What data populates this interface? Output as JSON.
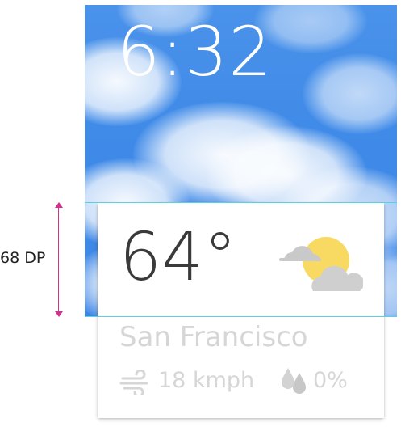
{
  "watch_face": {
    "time": "6:32"
  },
  "annotation": {
    "height_label": "68 DP",
    "colors": {
      "guide": "#5ad0e0",
      "measure": "#d4308f"
    }
  },
  "weather_card": {
    "temperature": "64°",
    "condition_icon": "partly-cloudy-icon",
    "city": "San Francisco",
    "wind": {
      "icon": "wind-icon",
      "value": "18 kmph"
    },
    "precipitation": {
      "icon": "raindrops-icon",
      "value": "0%"
    }
  },
  "colors": {
    "sky": "#4a92ea",
    "sun": "#f8da62",
    "cloud": "#cfcfcf",
    "primary_text": "#3a3a3a",
    "faded_text": "#d6d6d6"
  }
}
